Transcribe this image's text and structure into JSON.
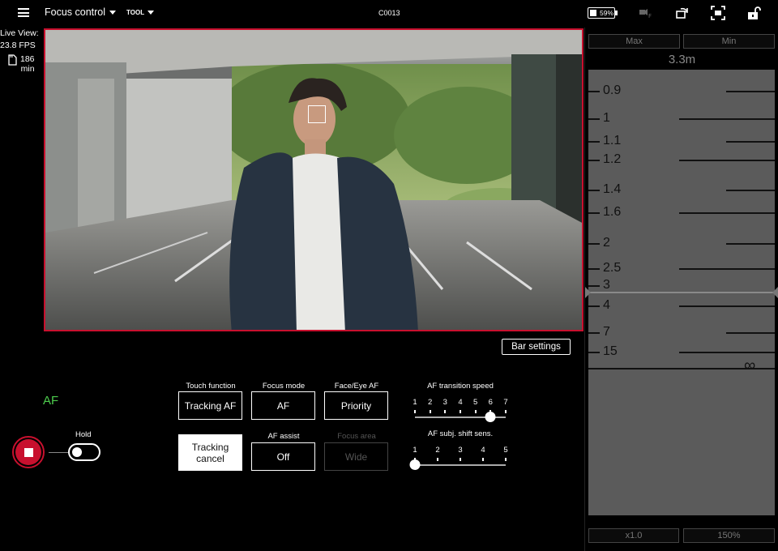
{
  "topbar": {
    "mode": "Focus control",
    "tool": "TOOL",
    "clip": "C0013",
    "battery": "59%"
  },
  "stats": {
    "live_view_label": "Live View:",
    "fps": "23.8 FPS",
    "remaining_value": "186",
    "remaining_unit": "min"
  },
  "ruler": {
    "max_label": "Max",
    "min_label": "Min",
    "distance": "3.3m",
    "ticks": [
      {
        "label": "0.9",
        "y": 0.9
      },
      {
        "label": "1",
        "y": 1
      },
      {
        "label": "1.1",
        "y": 1.1
      },
      {
        "label": "1.2",
        "y": 1.2
      },
      {
        "label": "1.4",
        "y": 1.4
      },
      {
        "label": "1.6",
        "y": 1.6
      },
      {
        "label": "2",
        "y": 2
      },
      {
        "label": "2.5",
        "y": 2.5
      },
      {
        "label": "3",
        "y": 3
      },
      {
        "label": "4",
        "y": 4
      },
      {
        "label": "7",
        "y": 7
      },
      {
        "label": "15",
        "y": 15
      }
    ],
    "infinity": "∞",
    "zoom_label": "x1.0",
    "magnify_label": "150%"
  },
  "bar_settings_label": "Bar settings",
  "af_status": "AF",
  "hold_label": "Hold",
  "controls": {
    "touch_function": {
      "label": "Touch function",
      "value": "Tracking AF"
    },
    "focus_mode": {
      "label": "Focus mode",
      "value": "AF"
    },
    "face_eye_af": {
      "label": "Face/Eye AF",
      "value": "Priority"
    },
    "tracking_cancel": {
      "line1": "Tracking",
      "line2": "cancel"
    },
    "af_assist": {
      "label": "AF assist",
      "value": "Off"
    },
    "focus_area": {
      "label": "Focus area",
      "value": "Wide"
    }
  },
  "af_transition_speed": {
    "label": "AF transition speed",
    "steps": [
      "1",
      "2",
      "3",
      "4",
      "5",
      "6",
      "7"
    ],
    "value": 6
  },
  "af_subj_shift": {
    "label": "AF subj. shift sens.",
    "steps": [
      "1",
      "2",
      "3",
      "4",
      "5"
    ],
    "value": 1
  },
  "colors": {
    "record_red": "#c8102e",
    "af_green": "#4dcc4d"
  }
}
